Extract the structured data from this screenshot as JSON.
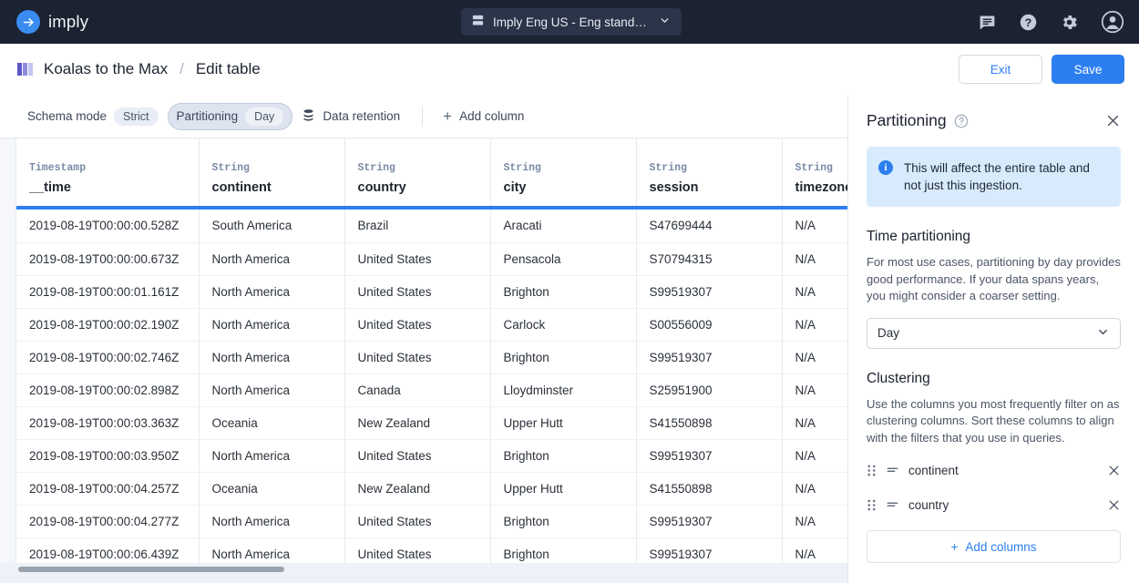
{
  "colors": {
    "accent": "#2d7ff0",
    "navbg": "#1b2231",
    "info_bg": "#d8ebfd",
    "chip": "#e8edf6"
  },
  "topnav": {
    "brand": "imply",
    "brand_icon": "arrow-right-circle-icon",
    "cluster": {
      "label": "Imply Eng US - Eng stand…",
      "icon": "server-icon",
      "chevron": "chevron-down-icon"
    },
    "icons": [
      "feedback-icon",
      "help-circle-icon",
      "gear-icon",
      "account-circle-icon"
    ]
  },
  "breadcrumb": {
    "table_icon": "table-columns-icon",
    "title": "Koalas to the Max",
    "separator": "/",
    "subtitle": "Edit table",
    "exit_label": "Exit",
    "save_label": "Save"
  },
  "toolbar": {
    "schema_mode_label": "Schema mode",
    "schema_mode_value": "Strict",
    "partitioning_label": "Partitioning",
    "partitioning_value": "Day",
    "data_retention_label": "Data retention",
    "data_retention_icon": "database-icon",
    "add_column_label": "Add column",
    "add_column_icon": "plus-icon"
  },
  "grid": {
    "columns": [
      {
        "type": "Timestamp",
        "name": "__time"
      },
      {
        "type": "String",
        "name": "continent"
      },
      {
        "type": "String",
        "name": "country"
      },
      {
        "type": "String",
        "name": "city"
      },
      {
        "type": "String",
        "name": "session"
      },
      {
        "type": "String",
        "name": "timezone"
      }
    ],
    "rows": [
      [
        "2019-08-19T00:00:00.528Z",
        "South America",
        "Brazil",
        "Aracati",
        "S47699444",
        "N/A"
      ],
      [
        "2019-08-19T00:00:00.673Z",
        "North America",
        "United States",
        "Pensacola",
        "S70794315",
        "N/A"
      ],
      [
        "2019-08-19T00:00:01.161Z",
        "North America",
        "United States",
        "Brighton",
        "S99519307",
        "N/A"
      ],
      [
        "2019-08-19T00:00:02.190Z",
        "North America",
        "United States",
        "Carlock",
        "S00556009",
        "N/A"
      ],
      [
        "2019-08-19T00:00:02.746Z",
        "North America",
        "United States",
        "Brighton",
        "S99519307",
        "N/A"
      ],
      [
        "2019-08-19T00:00:02.898Z",
        "North America",
        "Canada",
        "Lloydminster",
        "S25951900",
        "N/A"
      ],
      [
        "2019-08-19T00:00:03.363Z",
        "Oceania",
        "New Zealand",
        "Upper Hutt",
        "S41550898",
        "N/A"
      ],
      [
        "2019-08-19T00:00:03.950Z",
        "North America",
        "United States",
        "Brighton",
        "S99519307",
        "N/A"
      ],
      [
        "2019-08-19T00:00:04.257Z",
        "Oceania",
        "New Zealand",
        "Upper Hutt",
        "S41550898",
        "N/A"
      ],
      [
        "2019-08-19T00:00:04.277Z",
        "North America",
        "United States",
        "Brighton",
        "S99519307",
        "N/A"
      ],
      [
        "2019-08-19T00:00:06.439Z",
        "North America",
        "United States",
        "Brighton",
        "S99519307",
        "N/A"
      ]
    ]
  },
  "panel": {
    "title": "Partitioning",
    "help_icon": "help-circle-icon",
    "close_icon": "close-icon",
    "callout": "This will affect the entire table and not just this ingestion.",
    "time_partitioning": {
      "title": "Time partitioning",
      "description": "For most use cases, partitioning by day provides good performance. If your data spans years, you might consider a coarser setting.",
      "selected": "Day"
    },
    "clustering": {
      "title": "Clustering",
      "description": "Use the columns you most frequently filter on as clustering columns. Sort these columns to align with the filters that you use in queries.",
      "columns": [
        "continent",
        "country"
      ],
      "add_label": "Add columns",
      "add_icon": "plus-icon"
    }
  }
}
